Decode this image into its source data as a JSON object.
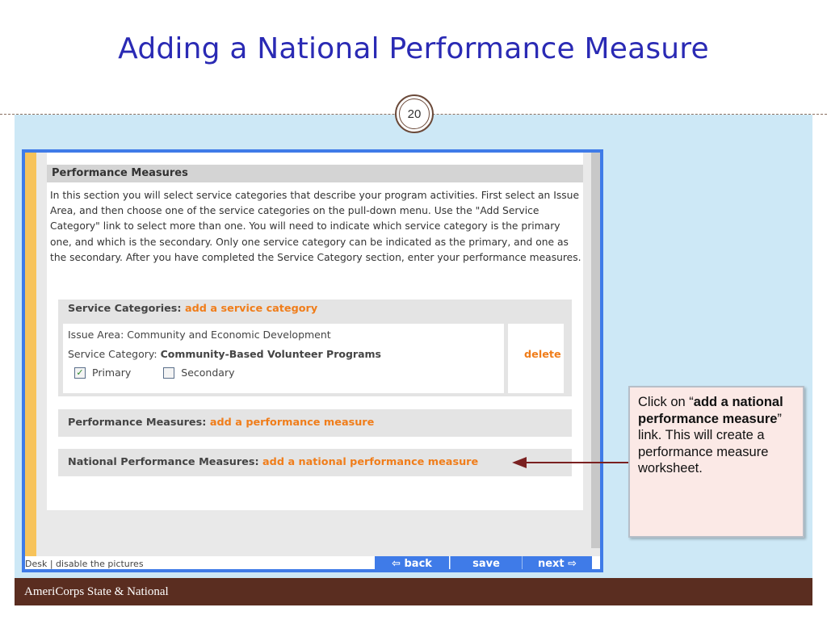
{
  "slide": {
    "title": "Adding a National Performance Measure",
    "page_number": "20",
    "footer": "AmeriCorps State & National"
  },
  "screenshot": {
    "section_header": "Performance Measures",
    "intro_text": "In this section you will select service categories that describe your program activities. First select an Issue Area, and then choose one of the service categories on the pull-down menu. Use the \"Add Service Category\" link to select more than one. You will need to indicate which service category is the primary one, and which is the secondary. Only one service category can be indicated as the primary, and one as the secondary. After you have completed the Service Category section, enter your performance measures.",
    "service_categories": {
      "label": "Service Categories:",
      "link": "add a service category",
      "issue_area": "Issue Area: Community and Economic Development",
      "service_category_label": "Service Category:",
      "service_category_value": "Community-Based Volunteer Programs",
      "primary_label": "Primary",
      "primary_checked": true,
      "secondary_label": "Secondary",
      "secondary_checked": false,
      "delete_label": "delete"
    },
    "performance_measures": {
      "label": "Performance Measures:",
      "link": "add a performance measure"
    },
    "national_performance_measures": {
      "label": "National Performance Measures:",
      "link": "add a national performance measure"
    },
    "nav": {
      "left_text": "Desk",
      "left_link": "disable the pictures",
      "back_label": "back",
      "save_label": "save",
      "next_label": "next"
    }
  },
  "callout": {
    "pre": "Click on “",
    "bold": "add a national performance measure",
    "post": "” link.  This will create a performance measure worksheet."
  },
  "colors": {
    "title": "#2a2ab4",
    "footer_bg": "#5a2d20",
    "content_bg": "#cde8f6",
    "frame_border": "#3f7be8",
    "link_orange": "#f07d1a",
    "arrow": "#7a2020"
  }
}
